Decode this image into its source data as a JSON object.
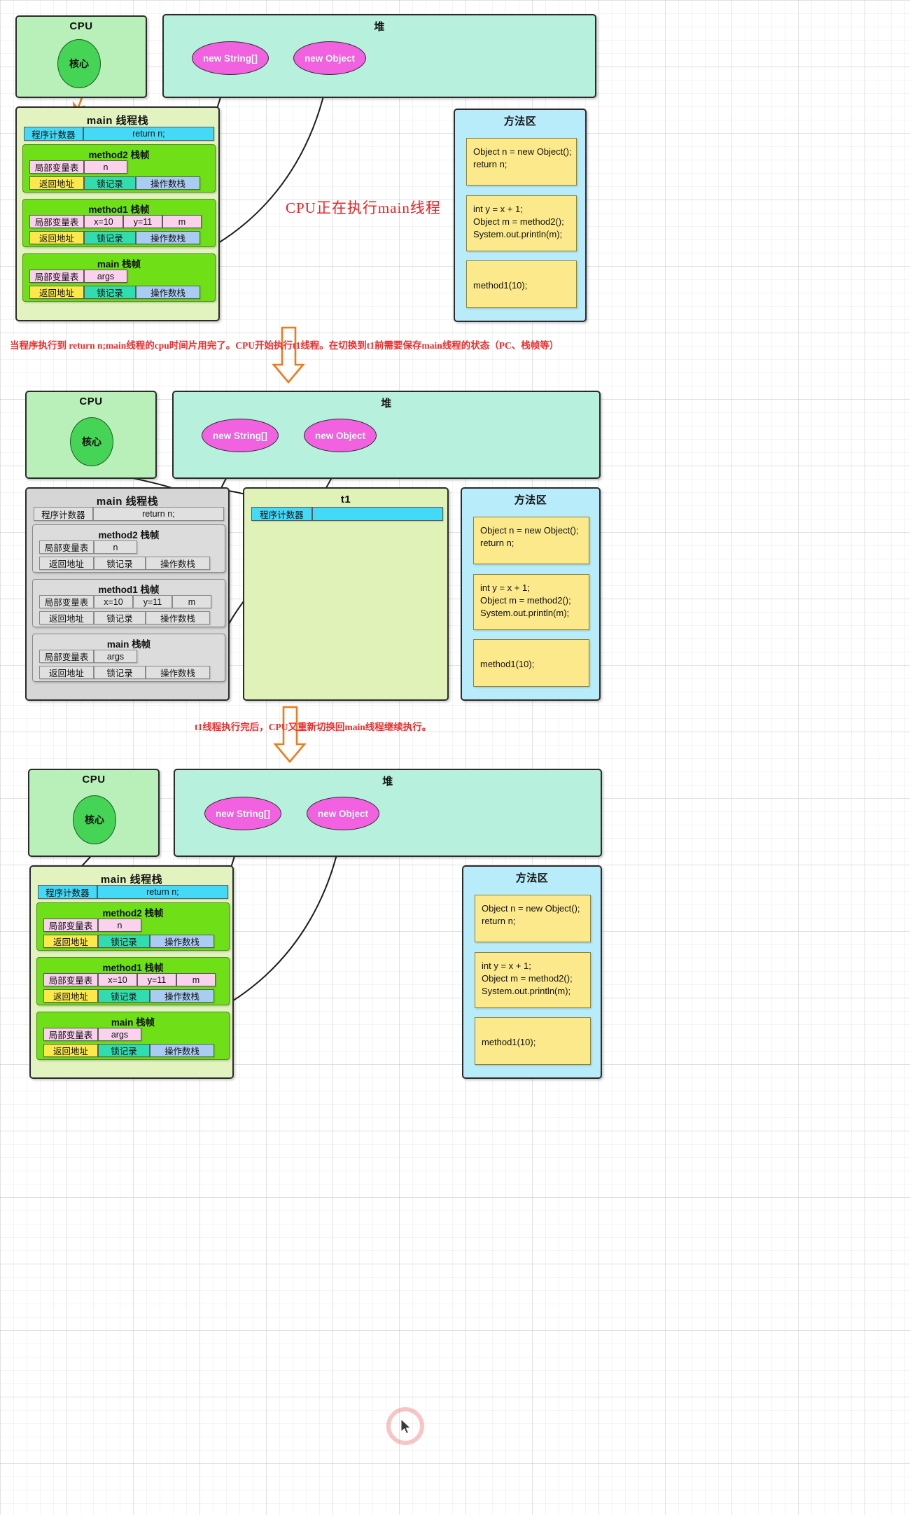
{
  "labels": {
    "cpu": "CPU",
    "core": "核心",
    "heap": "堆",
    "method_area": "方法区",
    "main_thread_stack": "main 线程栈",
    "t1_thread_stack": "t1",
    "program_counter": "程序计数器",
    "local_var_table": "局部变量表",
    "return_address": "返回地址",
    "lock_record": "锁记录",
    "operand_stack": "操作数栈"
  },
  "heap_objects": [
    {
      "name": "new String[]"
    },
    {
      "name": "new Object"
    }
  ],
  "method_area_code": [
    {
      "lines": [
        "Object n = new Object();",
        "return n;"
      ]
    },
    {
      "lines": [
        "int y = x + 1;",
        "Object m = method2();",
        "System.out.println(m);"
      ]
    },
    {
      "lines": [
        "method1(10);"
      ]
    }
  ],
  "main_stack": {
    "pc_value": "return n;",
    "frames": [
      {
        "title": "method2 栈帧",
        "vars": [
          "n"
        ]
      },
      {
        "title": "method1 栈帧",
        "vars": [
          "x=10",
          "y=11",
          "m"
        ]
      },
      {
        "title": "main 栈帧",
        "vars": [
          "args"
        ]
      }
    ]
  },
  "t1_stack": {
    "pc_value": ""
  },
  "annotations": {
    "stage1_note": "CPU正在执行main线程",
    "transition1": "当程序执行到 return n;main线程的cpu时间片用完了。CPU开始执行t1线程。在切换到t1前需要保存main线程的状态（PC、栈帧等）",
    "transition2": "t1线程执行完后，CPU又重新切换回main线程继续执行。"
  },
  "colors": {
    "cpu_bg": "#b9f0b9",
    "heap_bg": "#b7f0dd",
    "stack_bg": "#e3f3c0",
    "method_area_bg": "#b8ecfa",
    "frame_bg": "#6fe018",
    "object_bg": "#f261e0",
    "pc_bg": "#44d9f7",
    "code_bg": "#fbe98b",
    "accent_arrow": "#f07a1a",
    "caption_red": "#ef2b2b",
    "inactive_grey": "#d6d6d6"
  }
}
